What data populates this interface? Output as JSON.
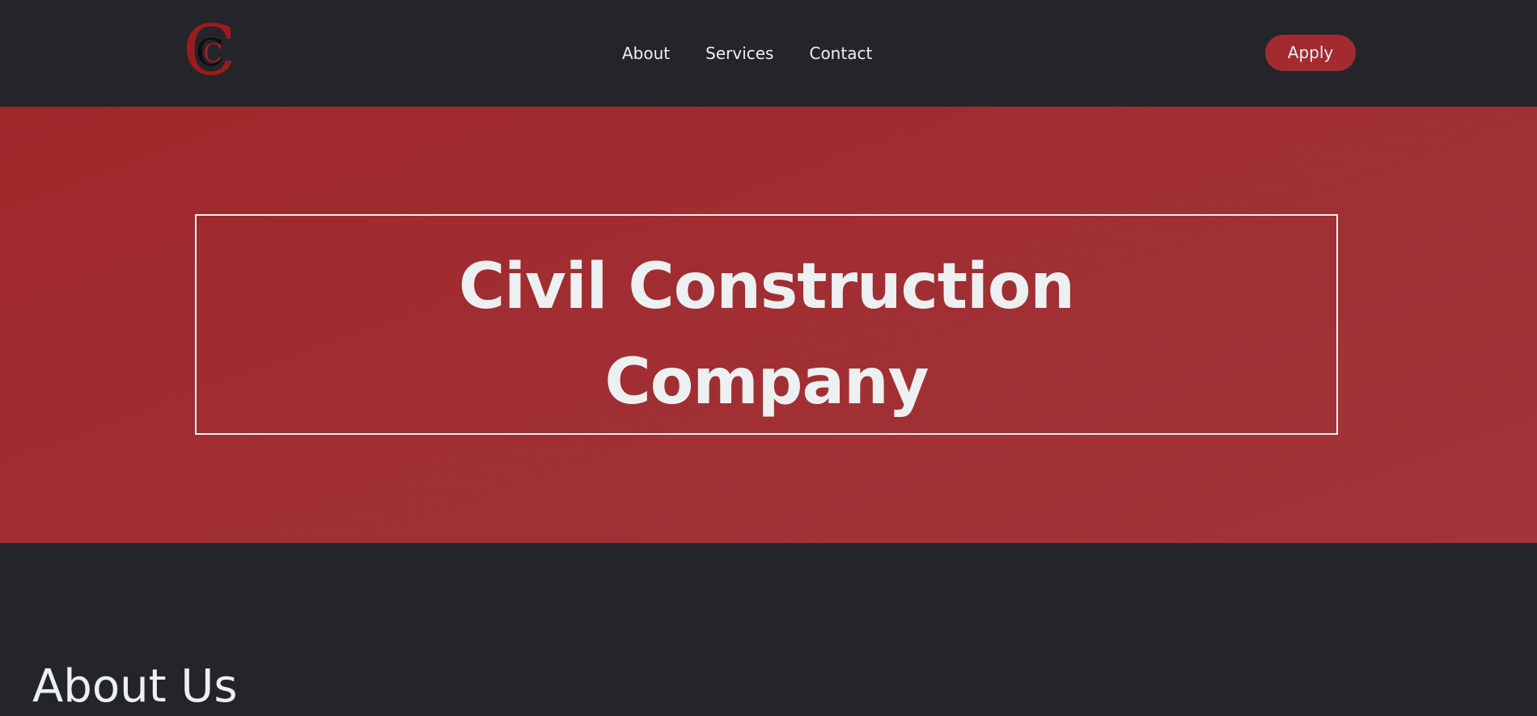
{
  "header": {
    "logo": {
      "outer_letter": "C",
      "inner_letter": "C"
    },
    "nav": [
      {
        "label": "About"
      },
      {
        "label": "Services"
      },
      {
        "label": "Contact"
      }
    ],
    "apply_label": "Apply"
  },
  "hero": {
    "title_line1": "Civil Construction",
    "title_line2": "Company"
  },
  "about": {
    "heading": "About Us"
  },
  "colors": {
    "background": "#24252a",
    "accent": "#a32b30",
    "hero_gradient_start": "#a0282b",
    "hero_gradient_end": "#a1353a",
    "text": "#edf0f1"
  }
}
